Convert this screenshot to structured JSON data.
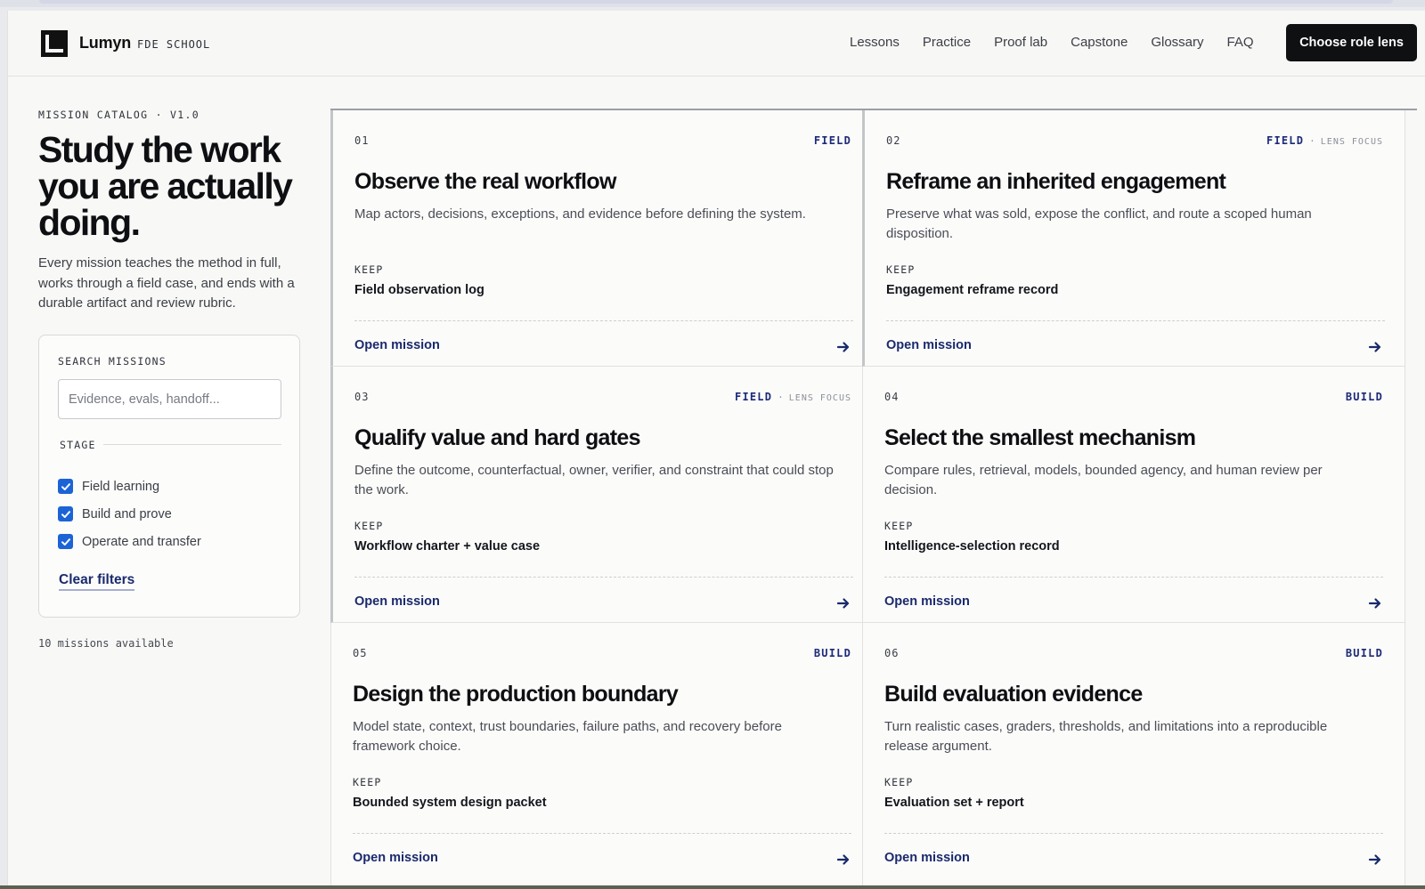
{
  "header": {
    "brand": "Lumyn",
    "brand_sub": "FDE SCHOOL",
    "nav": [
      "Lessons",
      "Practice",
      "Proof lab",
      "Capstone",
      "Glossary",
      "FAQ"
    ],
    "cta": "Choose role lens"
  },
  "sidebar": {
    "eyebrow": "MISSION CATALOG · V1.0",
    "headline": "Study the work you are actually doing.",
    "intro": "Every mission teaches the method in full, works through a field case, and ends with a durable artifact and review rubric.",
    "search": {
      "label": "SEARCH MISSIONS",
      "placeholder": "Evidence, evals, handoff...",
      "value": ""
    },
    "stage": {
      "label": "STAGE",
      "options": [
        {
          "label": "Field learning",
          "checked": true
        },
        {
          "label": "Build and prove",
          "checked": true
        },
        {
          "label": "Operate and transfer",
          "checked": true
        }
      ]
    },
    "clear": "Clear filters",
    "count": "10 missions available"
  },
  "missions": [
    {
      "num": "01",
      "tag": "FIELD",
      "lens": "",
      "title": "Observe the real workflow",
      "desc": "Map actors, decisions, exceptions, and evidence before defining the system.",
      "keep": "KEEP",
      "artifact": "Field observation log",
      "open": "Open mission"
    },
    {
      "num": "02",
      "tag": "FIELD",
      "lens": "LENS FOCUS",
      "title": "Reframe an inherited engagement",
      "desc": "Preserve what was sold, expose the conflict, and route a scoped human disposition.",
      "keep": "KEEP",
      "artifact": "Engagement reframe record",
      "open": "Open mission"
    },
    {
      "num": "03",
      "tag": "FIELD",
      "lens": "LENS FOCUS",
      "title": "Qualify value and hard gates",
      "desc": "Define the outcome, counterfactual, owner, verifier, and constraint that could stop the work.",
      "keep": "KEEP",
      "artifact": "Workflow charter + value case",
      "open": "Open mission"
    },
    {
      "num": "04",
      "tag": "BUILD",
      "lens": "",
      "title": "Select the smallest mechanism",
      "desc": "Compare rules, retrieval, models, bounded agency, and human review per decision.",
      "keep": "KEEP",
      "artifact": "Intelligence-selection record",
      "open": "Open mission"
    },
    {
      "num": "05",
      "tag": "BUILD",
      "lens": "",
      "title": "Design the production boundary",
      "desc": "Model state, context, trust boundaries, failure paths, and recovery before framework choice.",
      "keep": "KEEP",
      "artifact": "Bounded system design packet",
      "open": "Open mission"
    },
    {
      "num": "06",
      "tag": "BUILD",
      "lens": "",
      "title": "Build evaluation evidence",
      "desc": "Turn realistic cases, graders, thresholds, and limitations into a reproducible release argument.",
      "keep": "KEEP",
      "artifact": "Evaluation set + report",
      "open": "Open mission"
    }
  ],
  "colors": {
    "accent": "#1d2a78",
    "link": "#1a2a6c",
    "checkbox": "#1c63d6",
    "cta_bg": "#0f1012"
  }
}
